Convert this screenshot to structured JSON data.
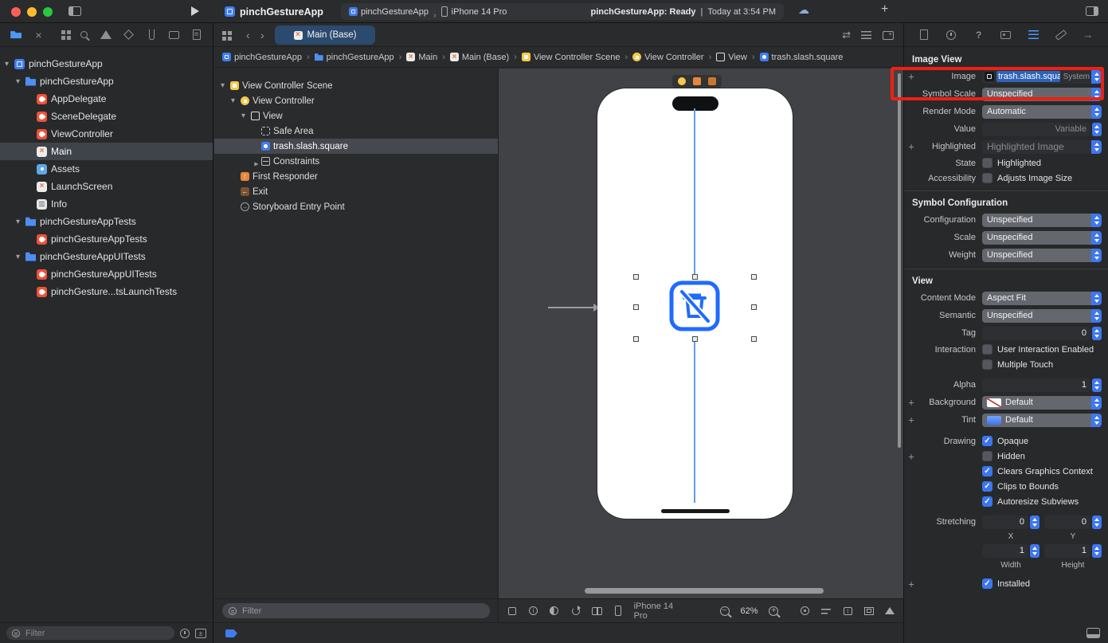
{
  "toolbar": {
    "title": "pinchGestureApp",
    "scheme_app": "pinchGestureApp",
    "scheme_device": "iPhone 14 Pro",
    "status_app": "pinchGestureApp: Ready",
    "status_divider": "|",
    "status_time": "Today at 3:54 PM"
  },
  "navigator": {
    "filter_placeholder": "Filter",
    "files": [
      {
        "name": "pinchGestureApp",
        "icon": "project-icon"
      },
      {
        "name": "pinchGestureApp",
        "icon": "folder-icon"
      },
      {
        "name": "AppDelegate",
        "icon": "swift-file-icon"
      },
      {
        "name": "SceneDelegate",
        "icon": "swift-file-icon"
      },
      {
        "name": "ViewController",
        "icon": "swift-file-icon"
      },
      {
        "name": "Main",
        "icon": "storyboard-file-icon"
      },
      {
        "name": "Assets",
        "icon": "asset-catalog-icon"
      },
      {
        "name": "LaunchScreen",
        "icon": "storyboard-file-icon"
      },
      {
        "name": "Info",
        "icon": "plist-file-icon"
      },
      {
        "name": "pinchGestureAppTests",
        "icon": "folder-icon"
      },
      {
        "name": "pinchGestureAppTests",
        "icon": "swift-file-icon"
      },
      {
        "name": "pinchGestureAppUITests",
        "icon": "folder-icon"
      },
      {
        "name": "pinchGestureAppUITests",
        "icon": "swift-file-icon"
      },
      {
        "name": "pinchGesture...tsLaunchTests",
        "icon": "swift-file-icon"
      }
    ]
  },
  "editor": {
    "tab_label": "Main (Base)",
    "breadcrumbs": [
      {
        "label": "pinchGestureApp",
        "icon": "project-icon"
      },
      {
        "label": "pinchGestureApp",
        "icon": "folder-icon"
      },
      {
        "label": "Main",
        "icon": "storyboard-file-icon"
      },
      {
        "label": "Main (Base)",
        "icon": "storyboard-file-icon"
      },
      {
        "label": "View Controller Scene",
        "icon": "scene-icon"
      },
      {
        "label": "View Controller",
        "icon": "view-controller-icon"
      },
      {
        "label": "View",
        "icon": "view-icon"
      },
      {
        "label": "trash.slash.square",
        "icon": "image-view-icon"
      }
    ],
    "outline": {
      "filter_placeholder": "Filter",
      "items": [
        {
          "label": "View Controller Scene"
        },
        {
          "label": "View Controller"
        },
        {
          "label": "View"
        },
        {
          "label": "Safe Area"
        },
        {
          "label": "trash.slash.square"
        },
        {
          "label": "Constraints"
        },
        {
          "label": "First Responder"
        },
        {
          "label": "Exit"
        },
        {
          "label": "Storyboard Entry Point"
        }
      ]
    },
    "canvas": {
      "device_label": "iPhone 14 Pro",
      "zoom_label": "62%"
    }
  },
  "inspector": {
    "header_image_view": "Image View",
    "image": {
      "label": "Image",
      "value": "trash.slash.squar",
      "badge": "System"
    },
    "symbol_scale": {
      "label": "Symbol Scale",
      "value": "Unspecified"
    },
    "render_mode": {
      "label": "Render Mode",
      "value": "Automatic"
    },
    "value_row": {
      "label": "Value",
      "value": "Variable"
    },
    "highlighted": {
      "label": "Highlighted",
      "placeholder": "Highlighted Image"
    },
    "state": {
      "label": "State",
      "option": "Highlighted"
    },
    "accessibility": {
      "label": "Accessibility",
      "option": "Adjusts Image Size"
    },
    "header_symbol_configuration": "Symbol Configuration",
    "configuration": {
      "label": "Configuration",
      "value": "Unspecified"
    },
    "scale": {
      "label": "Scale",
      "value": "Unspecified"
    },
    "weight": {
      "label": "Weight",
      "value": "Unspecified"
    },
    "header_view": "View",
    "content_mode": {
      "label": "Content Mode",
      "value": "Aspect Fit"
    },
    "semantic": {
      "label": "Semantic",
      "value": "Unspecified"
    },
    "tag": {
      "label": "Tag",
      "value": "0"
    },
    "interaction": {
      "label": "Interaction",
      "option1": "User Interaction Enabled",
      "option2": "Multiple Touch"
    },
    "alpha": {
      "label": "Alpha",
      "value": "1"
    },
    "background": {
      "label": "Background",
      "value": "Default"
    },
    "tint": {
      "label": "Tint",
      "value": "Default"
    },
    "drawing": {
      "label": "Drawing",
      "opaque": "Opaque",
      "hidden": "Hidden",
      "clears": "Clears Graphics Context",
      "clips": "Clips to Bounds",
      "autoresize": "Autoresize Subviews"
    },
    "stretching": {
      "label": "Stretching",
      "x": "0",
      "y": "0",
      "w": "1",
      "h": "1",
      "x_label": "X",
      "y_label": "Y",
      "w_label": "Width",
      "h_label": "Height"
    },
    "installed": {
      "label": "Installed"
    },
    "colors": {
      "accent": "#3e77f2",
      "selection": "#2e63b8",
      "annotation": "#ec2113"
    }
  }
}
